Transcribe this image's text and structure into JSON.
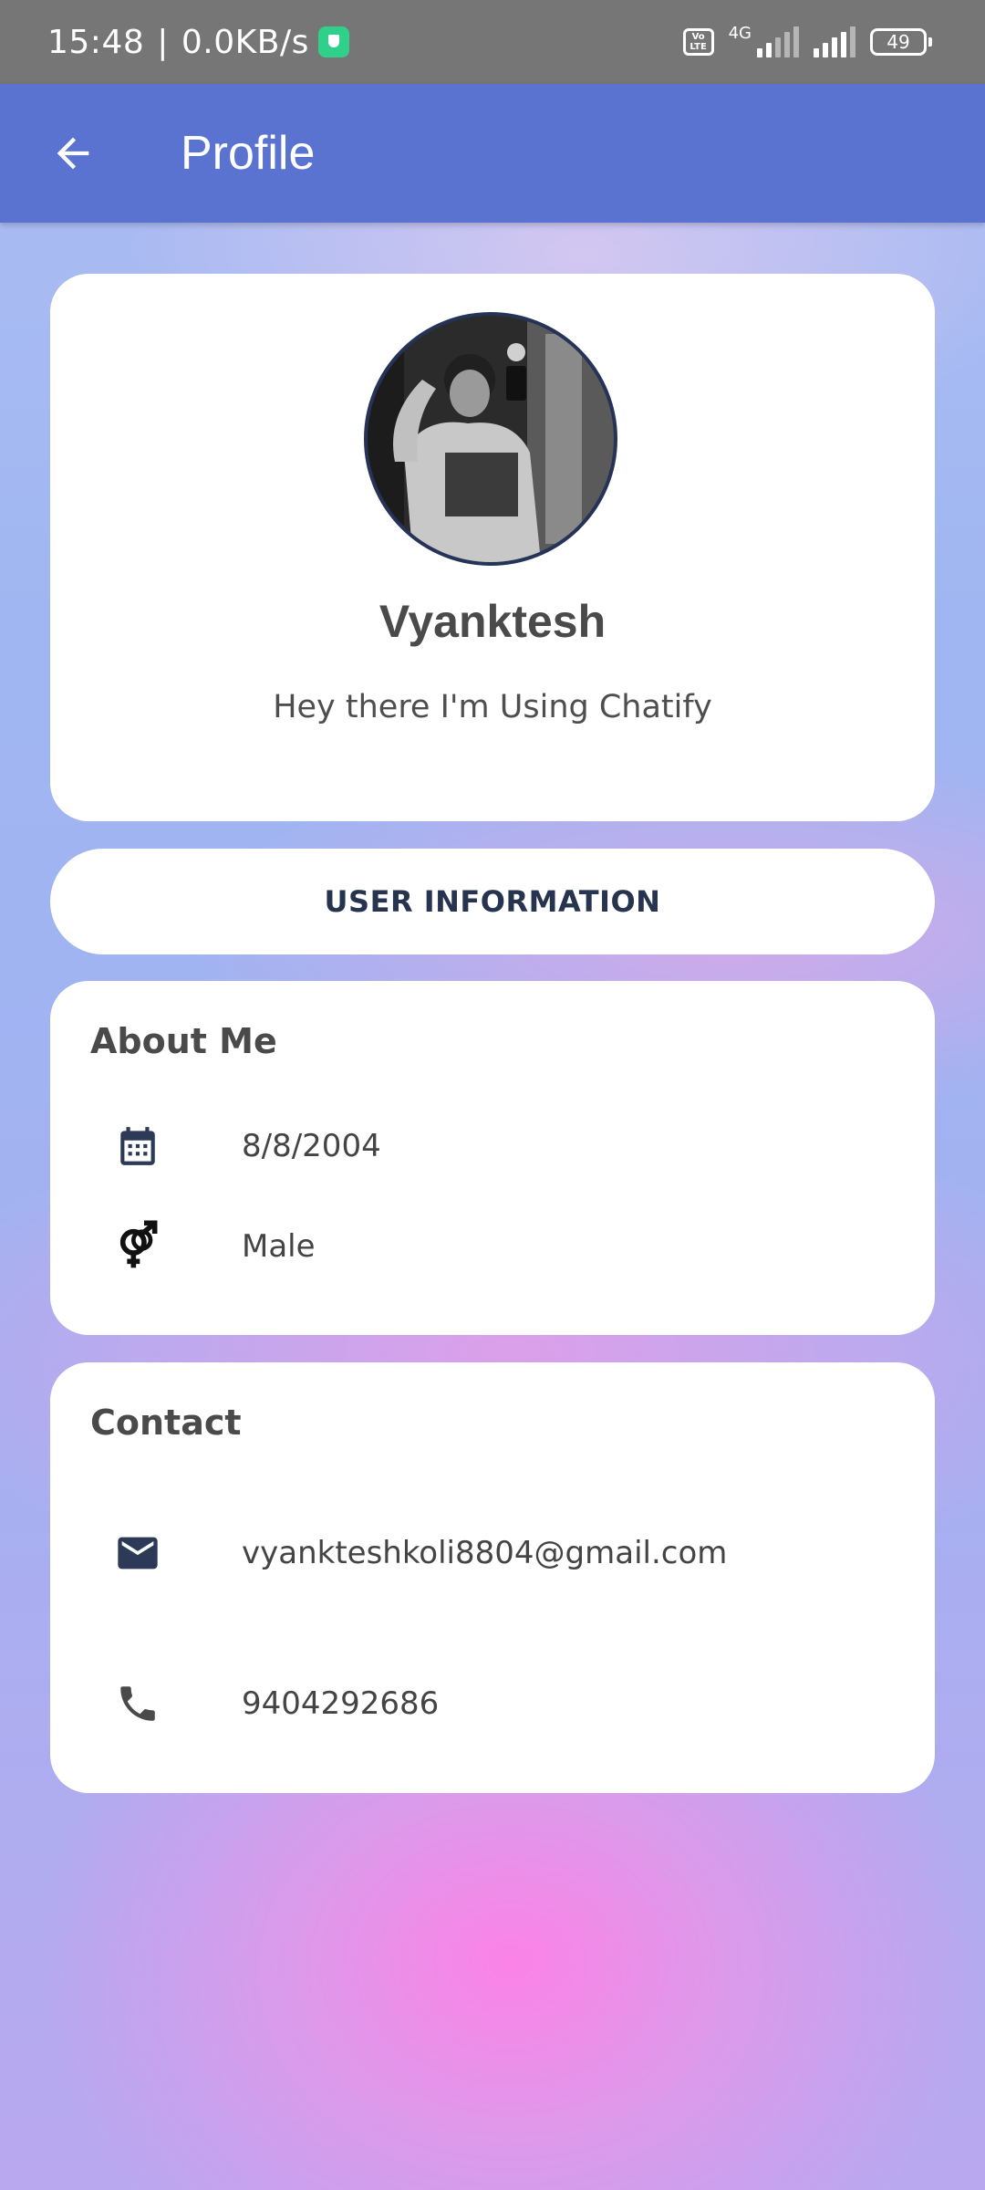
{
  "status_bar": {
    "time": "15:48",
    "separator": "|",
    "net_speed": "0.0KB/s",
    "volte_top": "Vo",
    "volte_bottom": "LTE",
    "network_type": "4G",
    "battery": "49"
  },
  "app_bar": {
    "title": "Profile",
    "back_icon": "arrow-back-icon"
  },
  "profile": {
    "name": "Vyanktesh",
    "status": "Hey there I'm Using Chatify"
  },
  "user_info": {
    "label": "USER INFORMATION"
  },
  "about": {
    "title": "About Me",
    "birthdate": "8/8/2004",
    "gender": "Male",
    "birthdate_icon": "calendar-icon",
    "gender_icon": "gender-icon"
  },
  "contact": {
    "title": "Contact",
    "email": "vyankteshkoli8804@gmail.com",
    "phone": "9404292686",
    "email_icon": "mail-icon",
    "phone_icon": "phone-icon"
  },
  "colors": {
    "app_bar": "#5a72d0",
    "status_bar": "#767676",
    "card": "#ffffff",
    "accent_dark": "#27344f"
  }
}
